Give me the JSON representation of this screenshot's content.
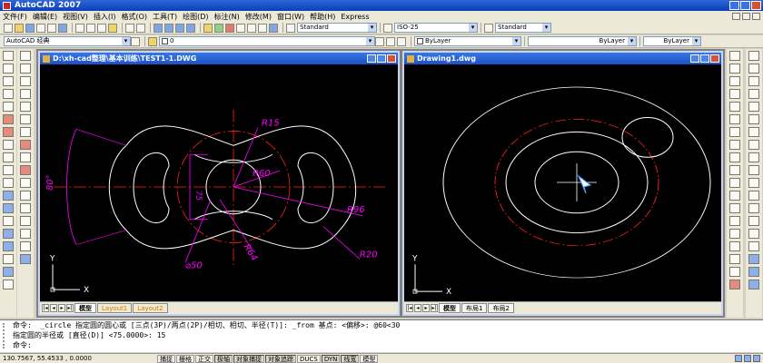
{
  "title": "AutoCAD 2007",
  "menu": [
    "文件(F)",
    "编辑(E)",
    "视图(V)",
    "插入(I)",
    "格式(O)",
    "工具(T)",
    "绘图(D)",
    "标注(N)",
    "修改(M)",
    "窗口(W)",
    "帮助(H)",
    "Express"
  ],
  "toolbar": {
    "text_style": "Standard",
    "dim_style": "ISO-25",
    "table_style": "Standard",
    "workspace": "AutoCAD 经典",
    "layer": "0",
    "color": "ByLayer",
    "linetype": "ByLayer",
    "lineweight": "ByLayer"
  },
  "windows": {
    "left": {
      "title": "D:\\xh-cad整理\\基本训练\\TEST1-1.DWG",
      "tabs": [
        "模型",
        "Layout1",
        "Layout2"
      ],
      "dims": {
        "r15": "R15",
        "r60": "R60",
        "r96": "R96",
        "r64": "R64",
        "r20": "R20",
        "d50": "⌀50",
        "a80": "80°",
        "v75": "75"
      },
      "axis_y": "Y",
      "axis_x": "X"
    },
    "right": {
      "title": "Drawing1.dwg",
      "tabs": [
        "模型",
        "布局1",
        "布局2"
      ],
      "axis_y": "Y",
      "axis_x": "X"
    }
  },
  "command": {
    "line1": "命令:  _circle 指定圆的圆心或 [三点(3P)/两点(2P)/相切、相切、半径(T)]: _from 基点: <偏移>: @60<30",
    "line2": "指定圆的半径或 [直径(D)] <75.0000>: 15",
    "line3": "命令:"
  },
  "status": {
    "coords": "130.7567, 55.4533 , 0.0000",
    "buttons": [
      "捕捉",
      "栅格",
      "正交",
      "极轴",
      "对象捕捉",
      "对象追踪",
      "DUCS",
      "DYN",
      "线宽",
      "模型"
    ]
  },
  "colors": {
    "dimension": "#ff00ff",
    "centerline": "#ff2020",
    "geometry": "#ffffff",
    "titlebar": "#0a3fb8"
  }
}
